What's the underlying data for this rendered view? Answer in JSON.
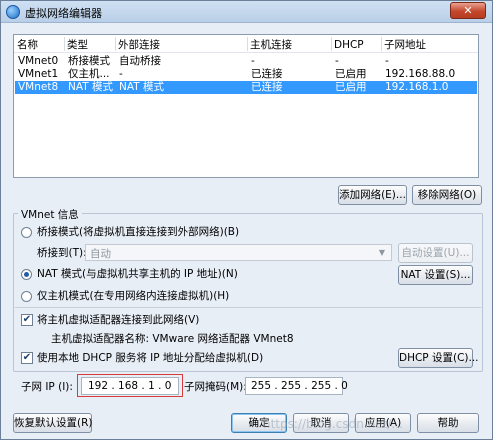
{
  "window": {
    "title": "虚拟网络编辑器",
    "close_label": "✕"
  },
  "table": {
    "columns": [
      "名称",
      "类型",
      "外部连接",
      "主机连接",
      "DHCP",
      "子网地址"
    ],
    "rows": [
      [
        "VMnet0",
        "桥接模式",
        "自动桥接",
        "-",
        "-",
        "-"
      ],
      [
        "VMnet1",
        "仅主机...",
        "-",
        "已连接",
        "已启用",
        "192.168.88.0"
      ],
      [
        "VMnet8",
        "NAT 模式",
        "NAT 模式",
        "已连接",
        "已启用",
        "192.168.1.0"
      ]
    ],
    "selected_index": 2
  },
  "buttons": {
    "add_network": "添加网络(E)...",
    "remove_network": "移除网络(O)",
    "auto_settings": "自动设置(U)...",
    "nat_settings": "NAT 设置(S)...",
    "dhcp_settings": "DHCP 设置(C)...",
    "restore_defaults": "恢复默认设置(R)",
    "ok": "确定",
    "cancel": "取消",
    "apply": "应用(A)",
    "help": "帮助"
  },
  "vmnet_info": {
    "title": "VMnet 信息",
    "bridged_label": "桥接模式(将虚拟机直接连接到外部网络)(B)",
    "bridged_to_label": "桥接到(T):",
    "bridged_to_value": "自动",
    "nat_label": "NAT 模式(与虚拟机共享主机的 IP 地址)(N)",
    "hostonly_label": "仅主机模式(在专用网络内连接虚拟机)(H)",
    "selected_mode": "nat",
    "connect_adapter_label": "将主机虚拟适配器连接到此网络(V)",
    "connect_adapter_checked": true,
    "adapter_name_label": "主机虚拟适配器名称: VMware 网络适配器 VMnet8",
    "dhcp_label": "使用本地 DHCP 服务将 IP 地址分配给虚拟机(D)",
    "dhcp_checked": true,
    "subnet_ip_label": "子网 IP (I):",
    "subnet_ip_value": "192 . 168 . 1 . 0",
    "subnet_mask_label": "子网掩码(M):",
    "subnet_mask_value": "255 . 255 . 255 . 0"
  },
  "watermark": "https://blog.csdn.net/...",
  "colors": {
    "selection": "#3399ff",
    "highlight_frame": "#d93b3b"
  }
}
